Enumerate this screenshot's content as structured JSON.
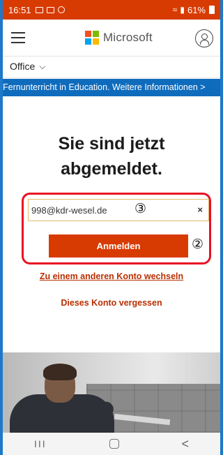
{
  "status_bar": {
    "time": "16:51",
    "battery_text": "61%",
    "icons": [
      "gallery-icon",
      "message-icon",
      "location-icon",
      "wifi-icon",
      "signal-icon",
      "battery-icon"
    ],
    "background": "#d83b01"
  },
  "header": {
    "brand": "Microsoft",
    "menu_icon": "hamburger-icon",
    "account_icon": "account-icon"
  },
  "office_menu": {
    "label": "Office",
    "icon": "chevron-down-icon"
  },
  "banner": {
    "text": "Fernunterricht in Education. Weitere Informationen >"
  },
  "main": {
    "headline_line1": "Sie sind jetzt",
    "headline_line2": "abgemeldet.",
    "email_value": "998@kdr-wesel.de",
    "clear_label": "×",
    "signin_label": "Anmelden",
    "switch_account_label": "Zu einem anderen Konto wechseln",
    "forget_account_label": "Dieses Konto vergessen"
  },
  "annotations": {
    "marker_email": "③",
    "marker_signin": "②"
  },
  "nav_bar": {
    "recents": "III",
    "home_icon": "home-icon",
    "back": "<"
  },
  "colors": {
    "accent": "#d83b01",
    "banner": "#0f6cbd",
    "annotation": "#e81123",
    "ms_red": "#f25022",
    "ms_green": "#7fba00",
    "ms_blue": "#00a4ef",
    "ms_yellow": "#ffb900"
  }
}
